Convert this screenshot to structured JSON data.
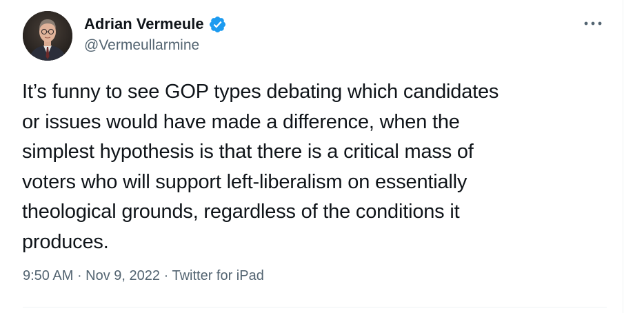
{
  "tweet": {
    "author": {
      "display_name": "Adrian Vermeule",
      "handle": "@Vermeullarmine",
      "verified": true,
      "avatar_icon": "profile-photo"
    },
    "more_icon": "ellipsis-icon",
    "text": "It’s funny to see GOP types debating which candidates\nor issues would have made a difference, when the\nsimplest hypothesis is that there is a critical mass of\nvoters who will support left-liberalism on essentially\ntheological grounds, regardless of the conditions it\nproduces.",
    "meta": {
      "time": "9:50 AM",
      "date": "Nov 9, 2022",
      "source": "Twitter for iPad",
      "separator": " · "
    }
  },
  "colors": {
    "text_primary": "#0f1419",
    "text_secondary": "#536471",
    "verified_blue": "#1d9bf0",
    "border": "#eff3f4"
  }
}
